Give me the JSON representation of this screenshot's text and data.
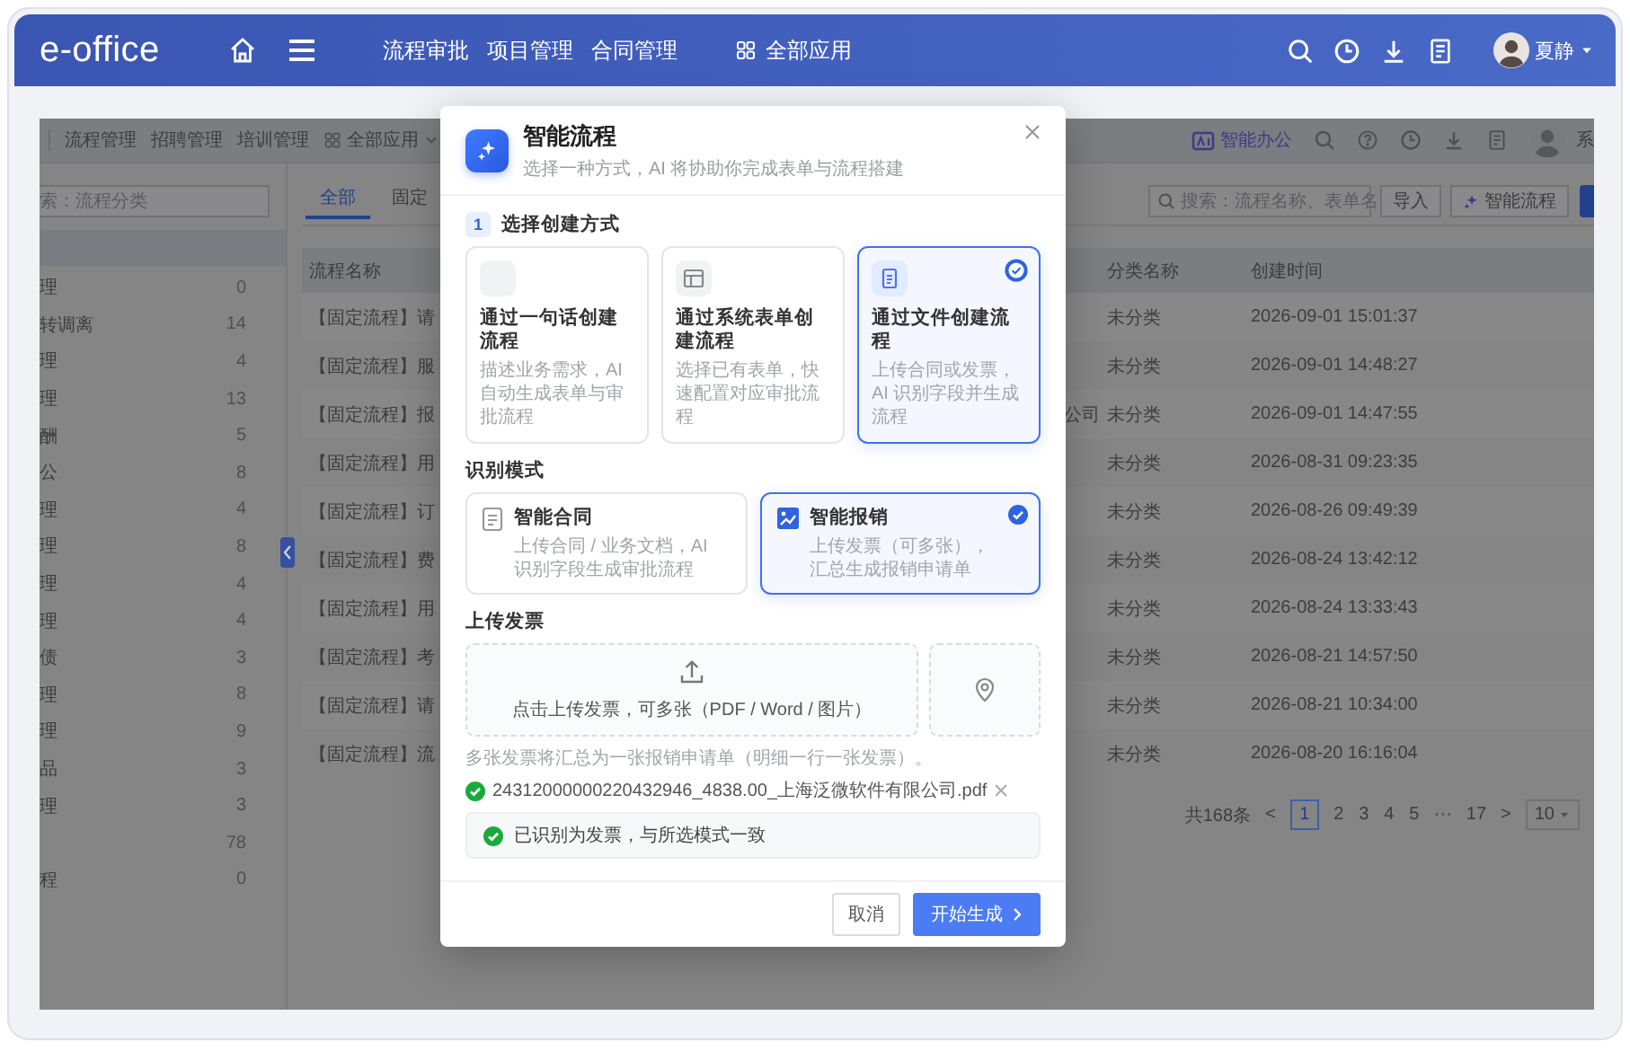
{
  "header": {
    "logo": "e-office",
    "nav": [
      "流程审批",
      "项目管理",
      "合同管理"
    ],
    "apps_label": "全部应用",
    "user": "夏静"
  },
  "app": {
    "top_nav": [
      "流程管理",
      "招聘管理",
      "培训管理"
    ],
    "apps_label": "全部应用",
    "smart_office": "智能办公",
    "user_fragment": "系",
    "sidebar": {
      "search": {
        "placeholder": "索：流程分类"
      },
      "items": [
        {
          "name": "理",
          "count": "0"
        },
        {
          "name": "转调离",
          "count": "14"
        },
        {
          "name": "理",
          "count": "4"
        },
        {
          "name": "理",
          "count": "13"
        },
        {
          "name": "酬",
          "count": "5"
        },
        {
          "name": "公",
          "count": "8"
        },
        {
          "name": "理",
          "count": "4"
        },
        {
          "name": "理",
          "count": "8"
        },
        {
          "name": "理",
          "count": "4"
        },
        {
          "name": "理",
          "count": "4"
        },
        {
          "name": "债",
          "count": "3"
        },
        {
          "name": "理",
          "count": "8"
        },
        {
          "name": "理",
          "count": "9"
        },
        {
          "name": "品",
          "count": "3"
        },
        {
          "name": "理",
          "count": "3"
        },
        {
          "count": "78"
        },
        {
          "name": "程",
          "count": "0"
        }
      ]
    },
    "tabs": [
      {
        "label": "全部",
        "selected": true
      },
      {
        "label": "固定",
        "selected": false
      }
    ],
    "search": {
      "placeholder": "搜索：流程名称、表单名"
    },
    "buttons": [
      "导入",
      "智能流程"
    ],
    "table": {
      "columns": [
        "流程名称",
        "分类名称",
        "创建时间"
      ],
      "rows": [
        {
          "name": "【固定流程】请",
          "category": "未分类",
          "created": "2026-09-01 15:01:37"
        },
        {
          "name": "【固定流程】服",
          "category": "未分类",
          "created": "2026-09-01 14:48:27"
        },
        {
          "name": "【固定流程】报",
          "column_2": "公司",
          "category": "未分类",
          "created": "2026-09-01 14:47:55"
        },
        {
          "name": "【固定流程】用",
          "category": "未分类",
          "created": "2026-08-31 09:23:35"
        },
        {
          "name": "【固定流程】订",
          "category": "未分类",
          "created": "2026-08-26 09:49:39"
        },
        {
          "name": "【固定流程】费",
          "category": "未分类",
          "created": "2026-08-24 13:42:12"
        },
        {
          "name": "【固定流程】用",
          "category": "未分类",
          "created": "2026-08-24 13:33:43"
        },
        {
          "name": "【固定流程】考",
          "category": "未分类",
          "created": "2026-08-21 14:57:50"
        },
        {
          "name": "【固定流程】请",
          "category": "未分类",
          "created": "2026-08-21 10:34:00"
        },
        {
          "name": "【固定流程】流",
          "category": "未分类",
          "created": "2026-08-20 16:16:04"
        }
      ]
    },
    "pagination": {
      "total": "共168条",
      "prev": "<",
      "pages": [
        {
          "label": "1",
          "selected": true
        },
        {
          "label": "2",
          "selected": false
        },
        {
          "label": "3",
          "selected": false
        },
        {
          "label": "4",
          "selected": false
        },
        {
          "label": "5",
          "selected": false
        },
        {
          "label": "···",
          "selected": false
        },
        {
          "label": "17",
          "selected": false
        }
      ],
      "next": ">",
      "page_size": "10"
    }
  },
  "dialog": {
    "title": "智能流程",
    "subtitle": "选择一种方式，AI 将协助你完成表单与流程搭建",
    "step": "1",
    "section_1": "选择创建方式",
    "methods": [
      {
        "kind": "prompt",
        "title": "通过一句话创建流程",
        "description": "描述业务需求，AI 自动生成表单与审批流程",
        "selected": false
      },
      {
        "kind": "form",
        "title": "通过系统表单创建流程",
        "description": "选择已有表单，快速配置对应审批流程",
        "selected": false
      },
      {
        "kind": "file",
        "title": "通过文件创建流程",
        "description": "上传合同或发票，AI 识别字段并生成流程",
        "selected": true
      }
    ],
    "section_2": "识别模式",
    "modes": [
      {
        "kind": "contract",
        "title": "智能合同",
        "description": "上传合同 / 业务文档，AI 识别字段生成审批流程",
        "selected": false
      },
      {
        "kind": "invoice",
        "title": "智能报销",
        "description": "上传发票（可多张），汇总生成报销申请单",
        "selected": true
      }
    ],
    "section_3": "上传发票",
    "upload_hint": "点击上传发票，可多张（PDF / Word / 图片）",
    "note": "多张发票将汇总为一张报销申请单（明细一行一张发票）。",
    "files": [
      {
        "name": "24312000000220432946_4838.00_上海泛微软件有限公司.pdf"
      }
    ],
    "status": "已识别为发票，与所选模式一致",
    "cancel": "取消",
    "confirm": "开始生成"
  }
}
